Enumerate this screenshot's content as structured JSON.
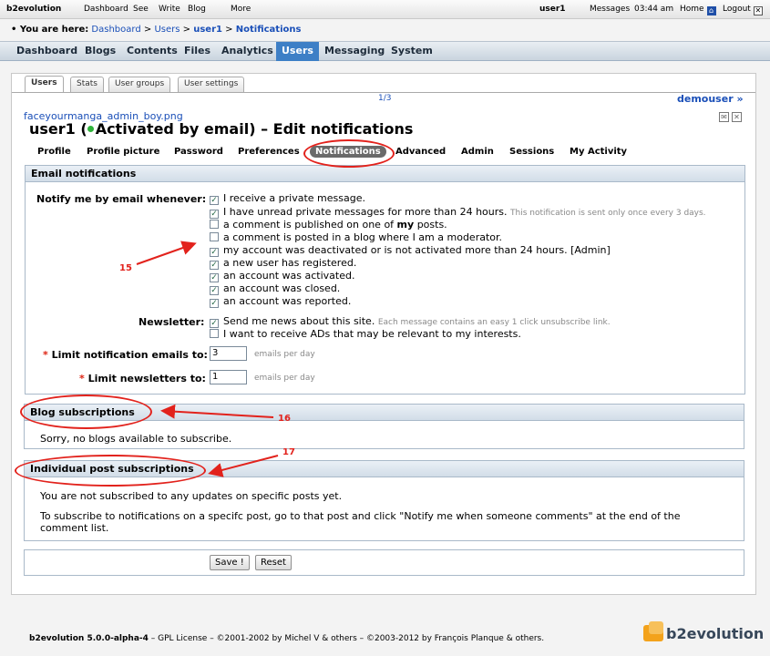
{
  "topbar": {
    "brand": "b2evolution",
    "items": [
      "Dashboard",
      "See",
      "Write",
      "Blog",
      "More"
    ],
    "user": "user1",
    "messages": "Messages",
    "time": "03:44 am",
    "home": "Home",
    "logout": "Logout"
  },
  "breadcrumb": {
    "prefix": "• You are here:",
    "items": [
      "Dashboard",
      "Users",
      "user1",
      "Notifications"
    ],
    "sep": ">"
  },
  "mainmenu": [
    "Dashboard",
    "Blogs",
    "Contents",
    "Files",
    "Analytics",
    "Users",
    "Messaging",
    "System"
  ],
  "subtabs": [
    "Users",
    "Stats",
    "User groups",
    "User settings"
  ],
  "pager": "1/3",
  "demouser": "demouser »",
  "filename": "faceyourmanga_admin_boy.png",
  "title": {
    "user": "user1",
    "open": "(",
    "status": "Activated by email",
    "close": ")",
    "suffix": "– Edit notifications"
  },
  "usertabs": [
    "Profile",
    "Profile picture",
    "Password",
    "Preferences",
    "Notifications",
    "Advanced",
    "Admin",
    "Sessions",
    "My Activity"
  ],
  "email_notifications": {
    "legend": "Email notifications",
    "notify_label": "Notify me by email whenever:",
    "options": [
      {
        "text": "I receive a private message.",
        "checked": true,
        "note": "",
        "bold": ""
      },
      {
        "text": "I have unread private messages for more than 24 hours.",
        "checked": true,
        "note": "This notification is sent only once every 3 days.",
        "bold": ""
      },
      {
        "text": "a comment is published on one of",
        "checked": false,
        "note": "",
        "bold": "my",
        "tail": "posts."
      },
      {
        "text": "a comment is posted in a blog where I am a moderator.",
        "checked": false,
        "note": "",
        "bold": ""
      },
      {
        "text": "my account was deactivated or is not activated more than 24 hours. [Admin]",
        "checked": true,
        "note": "",
        "bold": ""
      },
      {
        "text": "a new user has registered.",
        "checked": true,
        "note": "",
        "bold": ""
      },
      {
        "text": "an account was activated.",
        "checked": true,
        "note": "",
        "bold": ""
      },
      {
        "text": "an account was closed.",
        "checked": true,
        "note": "",
        "bold": ""
      },
      {
        "text": "an account was reported.",
        "checked": true,
        "note": "",
        "bold": ""
      }
    ],
    "newsletter_label": "Newsletter:",
    "newsletter": [
      {
        "text": "Send me news about this site.",
        "checked": true,
        "note": "Each message contains an easy 1 click unsubscribe link."
      },
      {
        "text": "I want to receive ADs that may be relevant to my interests.",
        "checked": false,
        "note": ""
      }
    ],
    "limit_emails_label": "Limit notification emails to:",
    "limit_emails_value": "3",
    "limit_emails_unit": "emails per day",
    "limit_news_label": "Limit newsletters to:",
    "limit_news_value": "1",
    "limit_news_unit": "emails per day",
    "required_mark": "*"
  },
  "blog_subscriptions": {
    "legend": "Blog subscriptions",
    "text": "Sorry, no blogs available to subscribe."
  },
  "post_subscriptions": {
    "legend": "Individual post subscriptions",
    "text1": "You are not subscribed to any updates on specific posts yet.",
    "text2a": "To subscribe to notifications on a specifc post, go to that post and click \"Notify me when someone comments\" at the end of the",
    "text2b": "comment list."
  },
  "buttons": {
    "save": "Save !",
    "reset": "Reset"
  },
  "annotations": [
    "15",
    "16",
    "17"
  ],
  "footer": {
    "version": "b2evolution 5.0.0-alpha-4",
    "rest": " – GPL License – ©2001-2002 by Michel V & others – ©2003-2012 by François Planque & others.",
    "logo": "b2evolution"
  },
  "colors": {
    "accent": "#3d7fc6",
    "link": "#1a4fb8",
    "annotation": "#e2221c"
  }
}
